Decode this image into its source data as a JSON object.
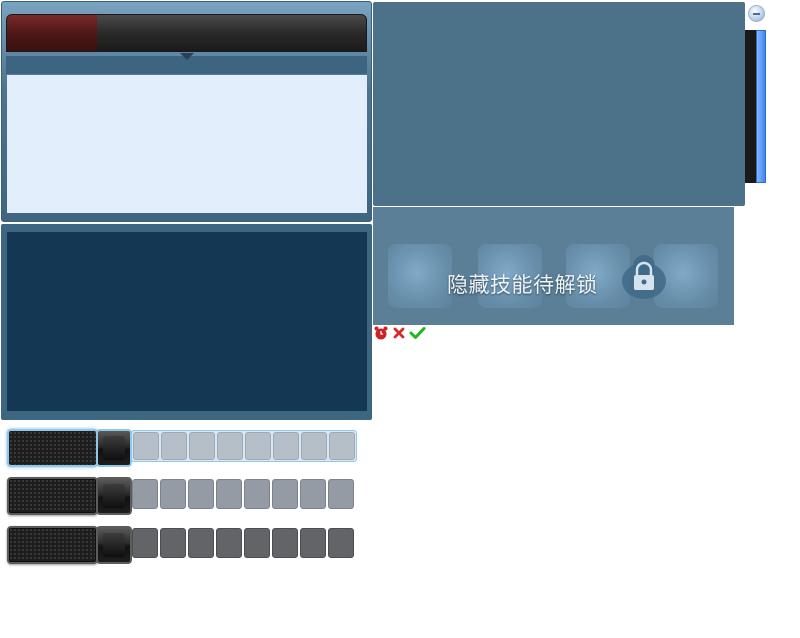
{
  "top_bar": {
    "fill_fraction": 0.25
  },
  "skill_panel": {
    "locked_text": "隐藏技能待解锁",
    "slots": [
      {
        "name": "skill-slot-1"
      },
      {
        "name": "skill-slot-2"
      },
      {
        "name": "skill-slot-3"
      },
      {
        "name": "skill-slot-4"
      }
    ]
  },
  "icons": {
    "alarm": "alarm-clock-icon",
    "close": "close-icon",
    "check": "check-icon",
    "scroll": "scroll-up-icon",
    "lock": "lock-icon"
  },
  "colors": {
    "bar_fill": "#5a1c1c",
    "panel_blue": "#4c7289",
    "dark_panel": "#143853",
    "alarm_red": "#cc2222",
    "close_red": "#d42a2a",
    "check_green": "#22b522"
  },
  "button_rows": [
    {
      "state": "active",
      "cell_style": "light",
      "cells": 8
    },
    {
      "state": "normal",
      "cell_style": "mid",
      "cells": 8
    },
    {
      "state": "normal",
      "cell_style": "dark",
      "cells": 8
    }
  ]
}
